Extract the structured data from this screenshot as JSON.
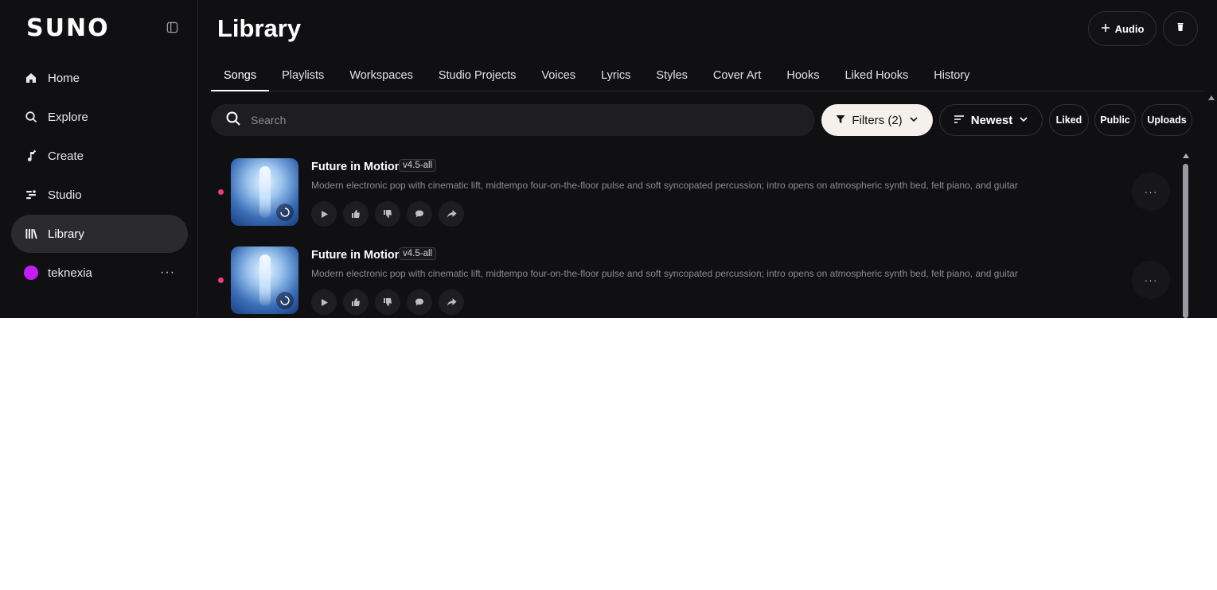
{
  "brand": {
    "logo": "SUNO"
  },
  "sidebar": {
    "items": [
      {
        "label": "Home",
        "icon": "home-icon"
      },
      {
        "label": "Explore",
        "icon": "search-icon"
      },
      {
        "label": "Create",
        "icon": "music-note-icon"
      },
      {
        "label": "Studio",
        "icon": "studio-icon"
      },
      {
        "label": "Library",
        "icon": "library-icon",
        "active": true
      }
    ],
    "user": {
      "name": "teknexia",
      "more": "···",
      "avatar_color": "#c51cf5"
    }
  },
  "header": {
    "title": "Library",
    "audio_button": "Audio"
  },
  "tabs": [
    {
      "label": "Songs",
      "active": true
    },
    {
      "label": "Playlists"
    },
    {
      "label": "Workspaces"
    },
    {
      "label": "Studio Projects"
    },
    {
      "label": "Voices"
    },
    {
      "label": "Lyrics"
    },
    {
      "label": "Styles"
    },
    {
      "label": "Cover Art"
    },
    {
      "label": "Hooks"
    },
    {
      "label": "Liked Hooks"
    },
    {
      "label": "History"
    }
  ],
  "toolbar": {
    "search_placeholder": "Search",
    "filters_label": "Filters (2)",
    "sort_label": "Newest",
    "liked_label": "Liked",
    "public_label": "Public",
    "uploads_label": "Uploads"
  },
  "songs": [
    {
      "title": "Future in Motion",
      "version": "v4.5-all",
      "description": "Modern electronic pop with cinematic lift, midtempo four-on-the-floor pulse and soft syncopated percussion; intro opens on atmospheric synth bed, felt piano, and guitar flicke...",
      "more": "···"
    },
    {
      "title": "Future in Motion",
      "version": "v4.5-all",
      "description": "Modern electronic pop with cinematic lift, midtempo four-on-the-floor pulse and soft syncopated percussion; intro opens on atmospheric synth bed, felt piano, and guitar flicke...",
      "more": "···"
    }
  ],
  "colors": {
    "background": "#101013",
    "accent_dot": "#ef3a7c",
    "filters_bg": "#f4f1ec"
  }
}
